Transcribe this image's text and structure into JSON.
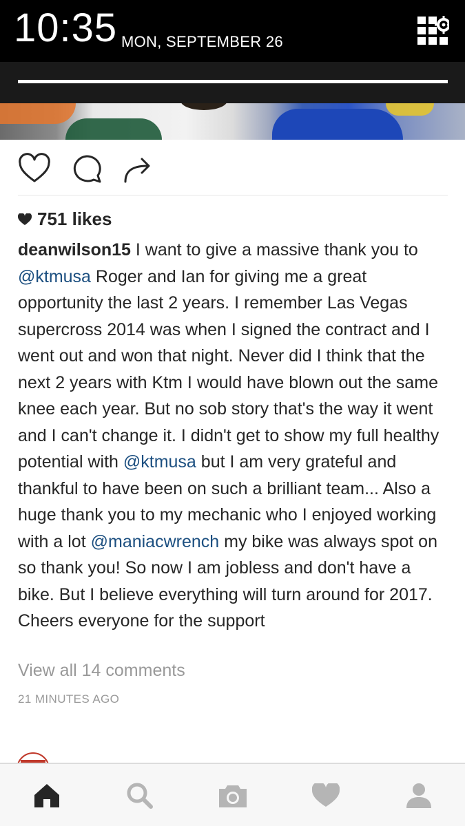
{
  "status_bar": {
    "time": "10:35",
    "date": "MON, SEPTEMBER 26",
    "quick_settings_icon": "grid-gear-icon"
  },
  "post": {
    "likes_text": "751 likes",
    "username": "deanwilson15",
    "caption_segments": [
      {
        "type": "text",
        "text": " I want to give a massive thank you to "
      },
      {
        "type": "mention",
        "text": "@ktmusa"
      },
      {
        "type": "text",
        "text": " Roger and Ian for giving me a great opportunity the last 2 years. I remember Las Vegas supercross 2014 was when I signed the contract and I went out and won that night. Never did I think that the next 2 years with Ktm I would have blown out the same knee each year. But no sob story that's the way it went and I can't change it. I didn't get to show my full healthy potential with "
      },
      {
        "type": "mention",
        "text": "@ktmusa"
      },
      {
        "type": "text",
        "text": " but I am very grateful and thankful to have been on such a brilliant team... Also a huge thank you to my mechanic who I enjoyed working with a lot "
      },
      {
        "type": "mention",
        "text": "@maniacwrench"
      },
      {
        "type": "text",
        "text": " my bike was always spot on so thank you! So now I am jobless and don't have a bike. But I believe everything will turn around for 2017. Cheers everyone for the support"
      }
    ],
    "view_comments": "View all 14 comments",
    "timestamp": "21 MINUTES AGO",
    "actions": [
      "heart-outline-icon",
      "comment-bubble-icon",
      "share-arrow-icon"
    ]
  },
  "tab_bar": {
    "tabs": [
      "home-icon",
      "search-icon",
      "camera-icon",
      "heart-icon",
      "profile-icon"
    ],
    "active": "home-icon",
    "active_color": "#262626",
    "inactive_color": "#b5b5b5"
  }
}
